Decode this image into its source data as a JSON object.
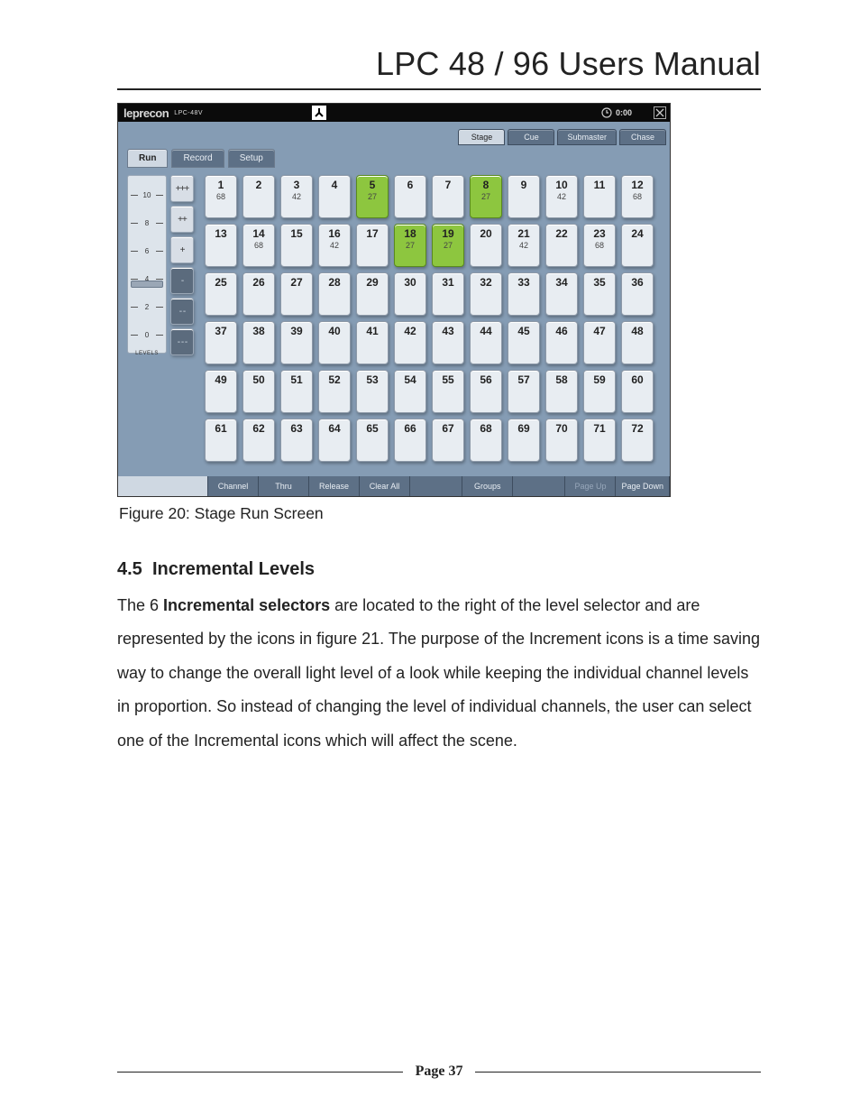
{
  "doc": {
    "title": "LPC 48 / 96 Users Manual",
    "figure_caption": "Figure 20: Stage Run Screen",
    "section_number": "4.5",
    "section_title": "Incremental Levels",
    "paragraph_pre": "The 6 ",
    "paragraph_bold": "Incremental selectors",
    "paragraph_post": " are located to the right of the level selector and are represented by the icons in figure 21. The purpose of the Increment icons is a time saving way to change the overall light level of a look while keeping the individual channel levels in proportion. So instead of changing the level of individual channels, the user can select one of the Incremental icons which will affect the scene.",
    "page_label": "Page 37"
  },
  "app": {
    "brand": "leprecon",
    "model": "LPC-48V",
    "clock": "0:00",
    "mode_tabs": [
      "Run",
      "Record",
      "Setup"
    ],
    "mode_active": 0,
    "view_tabs": [
      "Stage",
      "Cue",
      "Submaster",
      "Chase"
    ],
    "view_active": 0,
    "level_ticks": [
      "10",
      "8",
      "6",
      "4",
      "2",
      "0"
    ],
    "level_sub": "LEVELS",
    "inc_buttons": [
      {
        "label": "+++",
        "dark": false
      },
      {
        "label": "++",
        "dark": false
      },
      {
        "label": "+",
        "dark": false
      },
      {
        "label": "-",
        "dark": true
      },
      {
        "label": "- -",
        "dark": true
      },
      {
        "label": "- - -",
        "dark": true
      }
    ],
    "channel_values": {
      "1": "68",
      "3": "42",
      "5": "27",
      "8": "27",
      "10": "42",
      "12": "68",
      "14": "68",
      "16": "42",
      "18": "27",
      "19": "27",
      "21": "42",
      "23": "68"
    },
    "channel_active": [
      5,
      8,
      18,
      19
    ],
    "channel_start": 1,
    "channel_end": 72,
    "bottom_buttons": [
      "Channel",
      "Thru",
      "Release",
      "Clear All",
      "Groups",
      "Page Up",
      "Page Down"
    ]
  }
}
